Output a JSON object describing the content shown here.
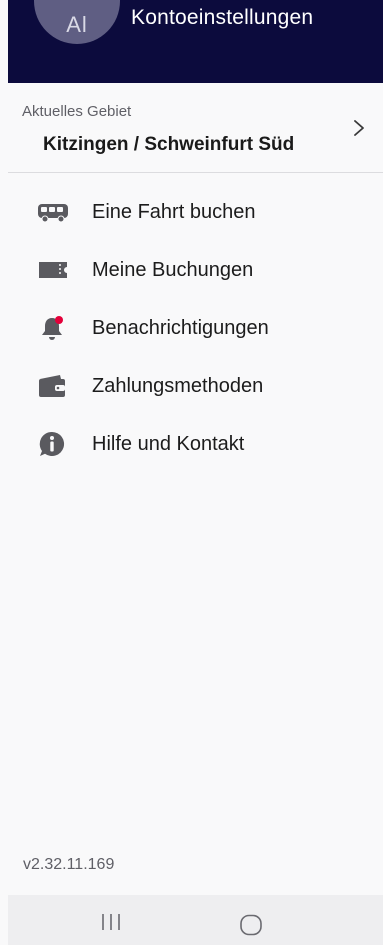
{
  "header": {
    "avatar_initials": "Al",
    "account_settings_label": "Kontoeinstellungen",
    "background_color": "#0c0b3d"
  },
  "area": {
    "label": "Aktuelles Gebiet",
    "value": "Kitzingen / Schweinfurt Süd"
  },
  "menu": {
    "items": [
      {
        "label": "Eine Fahrt buchen",
        "icon": "bus-icon"
      },
      {
        "label": "Meine Buchungen",
        "icon": "ticket-icon"
      },
      {
        "label": "Benachrichtigungen",
        "icon": "bell-icon",
        "badge_color": "#e4003a"
      },
      {
        "label": "Zahlungsmethoden",
        "icon": "wallet-icon"
      },
      {
        "label": "Hilfe und Kontakt",
        "icon": "info-icon"
      }
    ]
  },
  "version": "v2.32.11.169",
  "navbar": {
    "buttons": [
      "recents-icon",
      "home-icon"
    ]
  }
}
